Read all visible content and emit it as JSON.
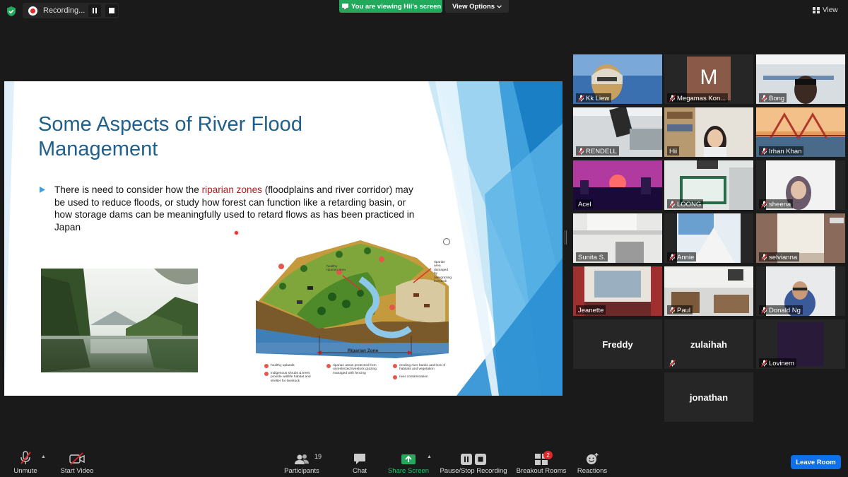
{
  "topbar": {
    "recording_label": "Recording...",
    "viewing_label": "You are viewing Hii's screen",
    "view_options_label": "View Options",
    "view_label": "View"
  },
  "slide": {
    "title": "Some Aspects of River Flood Management",
    "bullet_pre": "There is need to consider how the ",
    "bullet_highlight": "riparian zones",
    "bullet_post": " (floodplains and river corridor) may be used to reduce floods, or study how forest can function like a retarding basin, or how storage dams can be meaningfully used to retard flows as has been practiced in Japan",
    "highlight_color": "#b31b1b",
    "title_color": "#1f5f8c",
    "diagram": {
      "healthy_label": "healthy riparian area",
      "damaged_label": "riparian area damaged by overgrazing livestock",
      "zone_label": "Riparian Zone",
      "legend": [
        {
          "num": "1",
          "text": "healthy uplands"
        },
        {
          "num": "2",
          "text": "indigenous shrubs & trees provide wildlife habitat and shelter for livestock"
        },
        {
          "num": "3",
          "text": "riparian areas protected from unrestricted livestock grazing managed with fencing"
        },
        {
          "num": "4",
          "text": "eroding river banks and loss of habitats and vegetation"
        },
        {
          "num": "5",
          "text": "river contamination"
        }
      ]
    }
  },
  "participants": [
    {
      "name": "Kk Liew",
      "muted": true,
      "type": "video"
    },
    {
      "name": "Megamas Kon...",
      "muted": true,
      "type": "avatar",
      "initial": "M"
    },
    {
      "name": "Bong",
      "muted": true,
      "type": "video"
    },
    {
      "name": "RENDELL",
      "muted": true,
      "type": "video"
    },
    {
      "name": "Hii",
      "muted": false,
      "type": "video",
      "active": true
    },
    {
      "name": "Irhan Khan",
      "muted": true,
      "type": "video"
    },
    {
      "name": "Acel",
      "muted": false,
      "type": "video"
    },
    {
      "name": "LOONG",
      "muted": true,
      "type": "video"
    },
    {
      "name": "sheena",
      "muted": true,
      "type": "video"
    },
    {
      "name": "Sunita S.",
      "muted": false,
      "type": "video"
    },
    {
      "name": "Annie",
      "muted": true,
      "type": "video"
    },
    {
      "name": "selvianna",
      "muted": true,
      "type": "video"
    },
    {
      "name": "Jeanette",
      "muted": false,
      "type": "video"
    },
    {
      "name": "Paul",
      "muted": true,
      "type": "video"
    },
    {
      "name": "Donald Ng",
      "muted": true,
      "type": "video"
    },
    {
      "name": "Freddy",
      "muted": false,
      "type": "name"
    },
    {
      "name": "zulaihah",
      "muted": true,
      "type": "name"
    },
    {
      "name": "Lovinem",
      "muted": true,
      "type": "video"
    },
    {
      "name": "jonathan",
      "muted": false,
      "type": "name"
    }
  ],
  "toolbar": {
    "unmute": "Unmute",
    "start_video": "Start Video",
    "participants": "Participants",
    "participants_count": "19",
    "chat": "Chat",
    "share_screen": "Share Screen",
    "pause_recording": "Pause/Stop Recording",
    "breakout_rooms": "Breakout Rooms",
    "breakout_badge": "2",
    "reactions": "Reactions",
    "leave": "Leave Room"
  },
  "colors": {
    "share_green": "#23a95c",
    "leave_blue": "#0e71eb",
    "mute_red": "#e02828",
    "active_speaker": "#c9d92c"
  }
}
